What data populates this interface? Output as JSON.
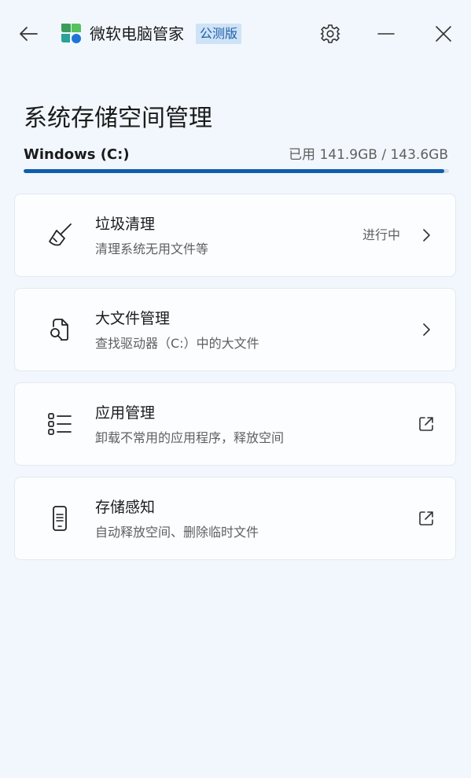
{
  "titlebar": {
    "app_name": "微软电脑管家",
    "badge": "公测版",
    "back_icon": "arrow-left-icon",
    "settings_icon": "gear-icon",
    "minimize_icon": "minimize-icon",
    "close_icon": "close-icon"
  },
  "page": {
    "title": "系统存储空间管理"
  },
  "drive": {
    "label": "Windows (C:)",
    "usage_text": "已用 141.9GB / 143.6GB",
    "used_gb": 141.9,
    "total_gb": 143.6,
    "bar_color": "#0e5eae"
  },
  "cards": [
    {
      "title": "垃圾清理",
      "desc": "清理系统无用文件等",
      "status": "进行中",
      "icon": "broom-icon",
      "action_icon": "chevron-right-icon"
    },
    {
      "title": "大文件管理",
      "desc": "查找驱动器（C:）中的大文件",
      "status": "",
      "icon": "file-search-icon",
      "action_icon": "chevron-right-icon"
    },
    {
      "title": "应用管理",
      "desc": "卸载不常用的应用程序，释放空间",
      "status": "",
      "icon": "app-list-icon",
      "action_icon": "open-external-icon"
    },
    {
      "title": "存储感知",
      "desc": "自动释放空间、删除临时文件",
      "status": "",
      "icon": "phone-storage-icon",
      "action_icon": "open-external-icon"
    }
  ]
}
